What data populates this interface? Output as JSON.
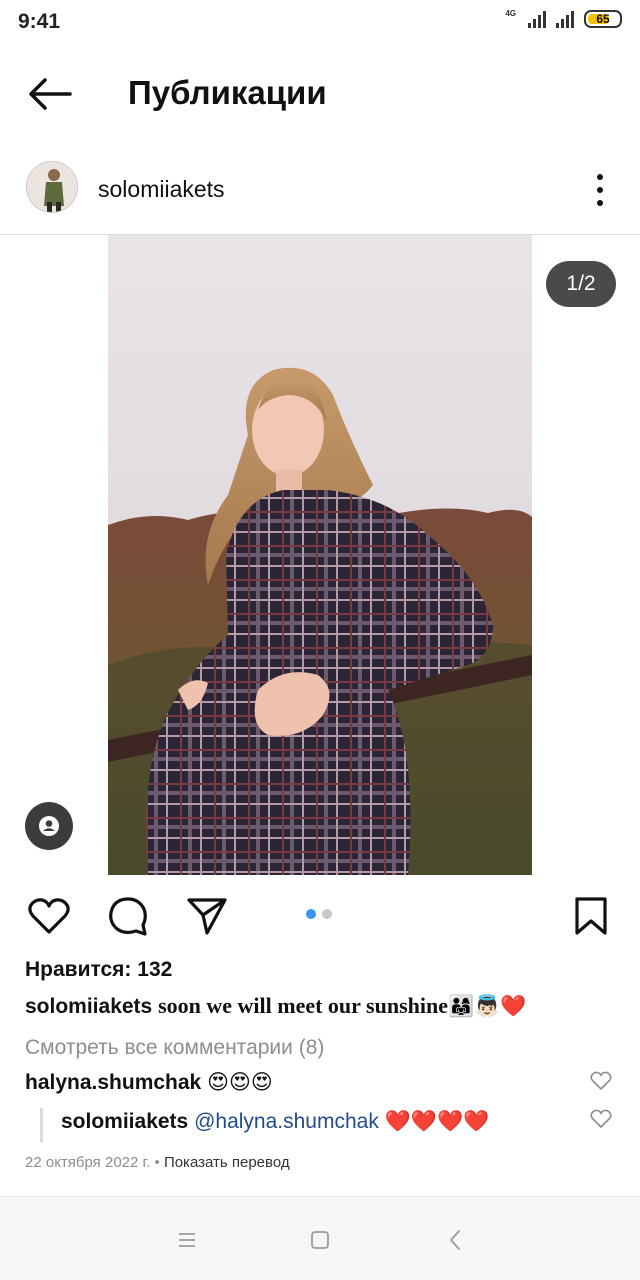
{
  "status_bar": {
    "time": "9:41",
    "network": "4G",
    "battery": "65",
    "icons": [
      "signal-1-icon",
      "signal-2-icon",
      "battery-icon"
    ]
  },
  "header": {
    "title": "Публикации",
    "back_icon": "arrow-left-icon"
  },
  "post": {
    "username": "solomiiakets",
    "image_counter": "1/2",
    "likes": "Нравится: 132",
    "caption": {
      "username": "solomiiakets",
      "text": "soon we will meet our sunshine",
      "emoji": "👨‍👩‍👧👼🏻❤️"
    },
    "view_comments": "Смотреть все комментарии (8)",
    "comments": [
      {
        "username": "halyna.shumchak",
        "text": "😍😍😍"
      }
    ],
    "reply": {
      "username": "solomiiakets",
      "mention": "@halyna.shumchak",
      "text": "❤️❤️❤️❤️"
    },
    "date": "22 октября 2022 г.",
    "separator": "•",
    "translate": "Показать перевод",
    "carousel": {
      "total": 2,
      "active": 1
    }
  },
  "colors": {
    "accent_blue": "#3897f0",
    "dot_inactive": "#c7c7c7",
    "mention": "#224b8f",
    "battery": "#f2c200",
    "muted": "#8e8e8e"
  }
}
